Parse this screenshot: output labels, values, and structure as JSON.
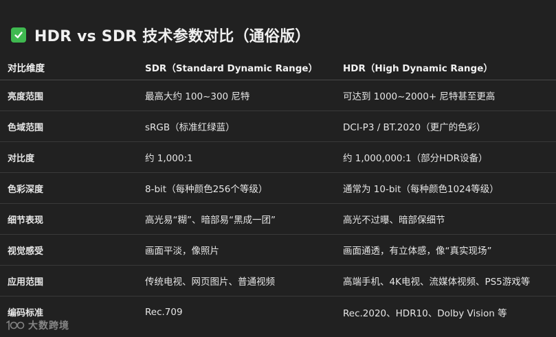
{
  "title": "HDR vs SDR 技术参数对比（通俗版）",
  "header_icon": "check-mark-icon",
  "accent_color": "#3fb950",
  "table": {
    "headers": [
      "对比维度",
      "SDR（Standard Dynamic Range）",
      "HDR（High Dynamic Range）"
    ],
    "rows": [
      [
        "亮度范围",
        "最高大约 100~300 尼特",
        "可达到 1000~2000+ 尼特甚至更高"
      ],
      [
        "色域范围",
        "sRGB（标准红绿蓝）",
        "DCI-P3 / BT.2020（更广的色彩）"
      ],
      [
        "对比度",
        "约 1,000:1",
        "约 1,000,000:1（部分HDR设备）"
      ],
      [
        "色彩深度",
        "8-bit（每种颜色256个等级）",
        "通常为 10-bit（每种颜色1024等级）"
      ],
      [
        "细节表现",
        "高光易“糊”、暗部易“黑成一团”",
        "高光不过曝、暗部保细节"
      ],
      [
        "视觉感受",
        "画面平淡，像照片",
        "画面通透，有立体感，像“真实现场”"
      ],
      [
        "应用范围",
        "传统电视、网页图片、普通视频",
        "高端手机、4K电视、流媒体视频、PS5游戏等"
      ],
      [
        "编码标准",
        "Rec.709",
        "Rec.2020、HDR10、Dolby Vision 等"
      ]
    ]
  },
  "watermark": {
    "logo_text": "100",
    "text": "大数跨境"
  }
}
